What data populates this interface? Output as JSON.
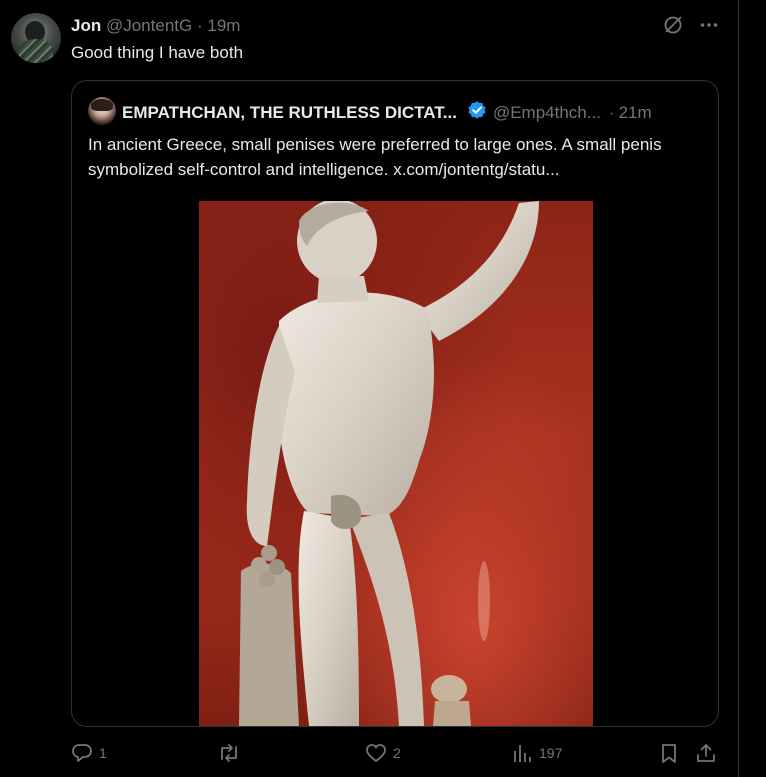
{
  "post": {
    "author_name": "Jon",
    "author_handle": "@JontentG",
    "separator": "·",
    "time": "19m",
    "text": "Good thing I have both",
    "top_icons": [
      "grok-icon",
      "more-icon"
    ]
  },
  "quoted": {
    "author_name": "EMPATHCHAN, THE RUTHLESS DICTAT...",
    "verified": true,
    "author_handle": "@Emp4thch...",
    "separator": "·",
    "time": "21m",
    "text": "In ancient Greece, small penises were preferred to large ones. A small penis symbolized self-control and intelligence.  x.com/jontentg/statu...",
    "image": "marble statue of a nude male figure against a red background"
  },
  "actions": {
    "replies": "1",
    "reposts": "",
    "likes": "2",
    "views": "197"
  },
  "colors": {
    "background": "#000000",
    "text": "#e7e9ea",
    "muted": "#71767b",
    "border": "#2f3336",
    "verified": "#1d9bf0"
  }
}
